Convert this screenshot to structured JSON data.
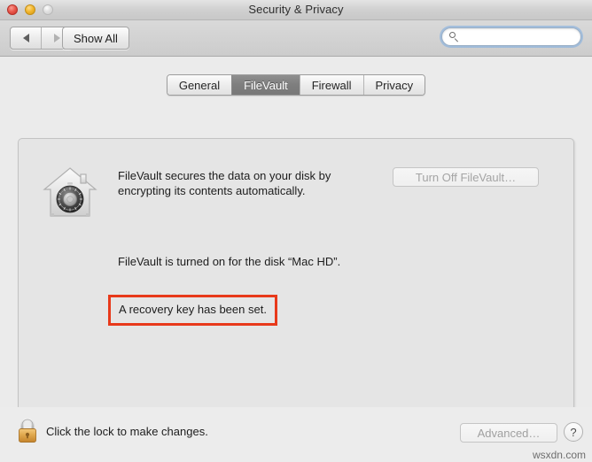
{
  "window": {
    "title": "Security & Privacy",
    "traffic_lights": [
      {
        "name": "close",
        "color": "#e8564a"
      },
      {
        "name": "minimize",
        "color": "#f1b52c"
      },
      {
        "name": "zoom",
        "color": "#dedede"
      }
    ]
  },
  "toolbar": {
    "back_label": "◀",
    "forward_label": "▶",
    "show_all_label": "Show All",
    "search": {
      "value": "",
      "placeholder": "",
      "icon": "search-icon"
    }
  },
  "tabs": [
    {
      "label": "General",
      "selected": false
    },
    {
      "label": "FileVault",
      "selected": true
    },
    {
      "label": "Firewall",
      "selected": false
    },
    {
      "label": "Privacy",
      "selected": false
    }
  ],
  "filevault": {
    "icon": "filevault-house-safe-icon",
    "description": "FileVault secures the data on your disk by encrypting its contents automatically.",
    "turn_off_button": "Turn Off FileVault…",
    "turn_off_enabled": false,
    "status_text": "FileVault is turned on for the disk “Mac HD”.",
    "recovery_text": "A recovery key has been set."
  },
  "annotation": {
    "highlight_color": "#e8391a",
    "target": "A recovery key has been set."
  },
  "footer": {
    "lock_icon": "lock-closed-icon",
    "lock_caption": "Click the lock to make changes.",
    "advanced_button": "Advanced…",
    "advanced_enabled": false,
    "help_button": "?"
  },
  "watermark": "wsxdn.com"
}
